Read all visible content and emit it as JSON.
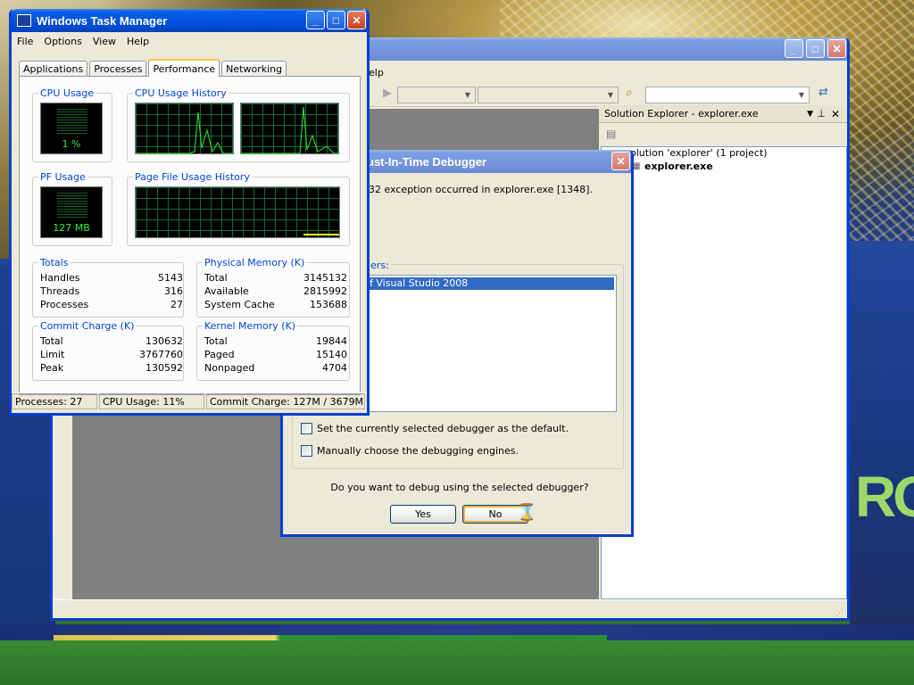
{
  "task_manager": {
    "title": "Windows Task Manager",
    "menu": [
      "File",
      "Options",
      "View",
      "Help"
    ],
    "tabs": [
      "Applications",
      "Processes",
      "Performance",
      "Networking"
    ],
    "active_tab": "Performance",
    "cpu_usage": {
      "title": "CPU Usage",
      "value": "1 %"
    },
    "cpu_history_title": "CPU Usage History",
    "pf_usage": {
      "title": "PF Usage",
      "value": "127 MB"
    },
    "pf_history_title": "Page File Usage History",
    "totals": {
      "title": "Totals",
      "rows": [
        [
          "Handles",
          "5143"
        ],
        [
          "Threads",
          "316"
        ],
        [
          "Processes",
          "27"
        ]
      ]
    },
    "physical_memory": {
      "title": "Physical Memory (K)",
      "rows": [
        [
          "Total",
          "3145132"
        ],
        [
          "Available",
          "2815992"
        ],
        [
          "System Cache",
          "153688"
        ]
      ]
    },
    "commit_charge": {
      "title": "Commit Charge (K)",
      "rows": [
        [
          "Total",
          "130632"
        ],
        [
          "Limit",
          "3767760"
        ],
        [
          "Peak",
          "130592"
        ]
      ]
    },
    "kernel_memory": {
      "title": "Kernel Memory (K)",
      "rows": [
        [
          "Total",
          "19844"
        ],
        [
          "Paged",
          "15140"
        ],
        [
          "Nonpaged",
          "4704"
        ]
      ]
    },
    "status": {
      "processes": "Processes: 27",
      "cpu": "CPU Usage: 11%",
      "commit": "Commit Charge: 127M / 3679M"
    }
  },
  "visual_studio": {
    "menu_fragment": "elp",
    "solution_explorer": {
      "header": "Solution Explorer - explorer.exe",
      "solution_label": "olution 'explorer' (1 project)",
      "project_label": "explorer.exe"
    }
  },
  "debugger": {
    "title": "ust-In-Time Debugger",
    "message": "32 exception occurred in explorer.exe [1348].",
    "debuggers_label": "ers:",
    "debugger_item": "f Visual Studio 2008",
    "checkbox_default": "Set the currently selected debugger as the default.",
    "checkbox_manual": "Manually choose the debugging engines.",
    "question": "Do you want to debug using the selected debugger?",
    "yes": "Yes",
    "no": "No"
  }
}
